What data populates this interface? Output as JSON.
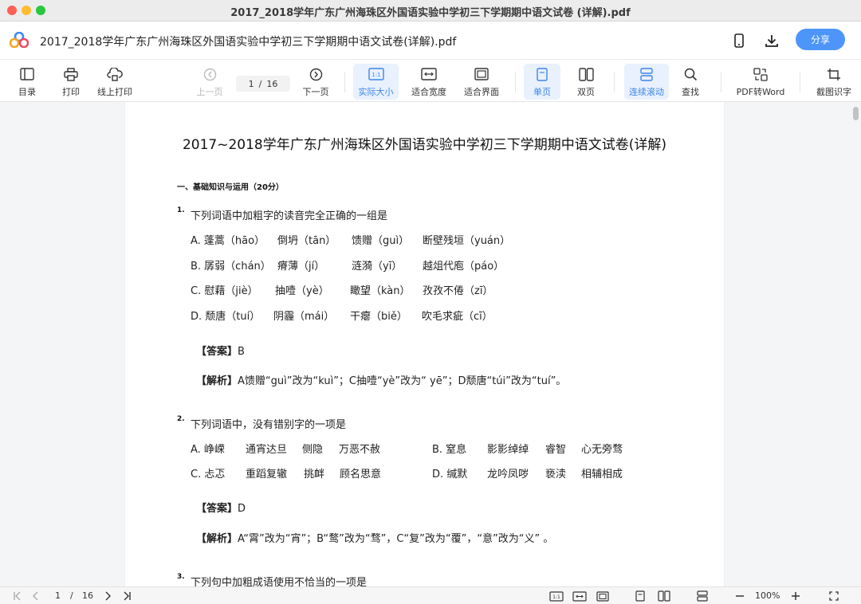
{
  "window": {
    "title": "2017_2018学年广东广州海珠区外国语实验中学初三下学期期中语文试卷 (详解).pdf"
  },
  "header": {
    "doc_title": "2017_2018学年广东广州海珠区外国语实验中学初三下学期期中语文试卷(详解).pdf",
    "share_label": "分享"
  },
  "toolbar": {
    "toc": "目录",
    "print": "打印",
    "online_print": "线上打印",
    "prev": "上一页",
    "current_page": "1",
    "separator": "/",
    "total_pages": "16",
    "next": "下一页",
    "actual_size": "实际大小",
    "fit_width": "适合宽度",
    "fit_page": "适合界面",
    "single_page": "单页",
    "double_page": "双页",
    "continuous": "连续滚动",
    "find": "查找",
    "pdf_to_word": "PDF转Word",
    "screenshot_ocr": "截图识字",
    "actual_size_icon_text": "1:1"
  },
  "document": {
    "title": "2017~2018学年广东广州海珠区外国语实验中学初三下学期期中语文试卷(详解)",
    "section": "一、基础知识与运用（20分）",
    "q1": {
      "num": "1.",
      "text": "下列词语中加粗字的读音完全正确的一组是",
      "options": [
        [
          "A. 蓬蒿（hāo）",
          "倒坍（tān）",
          "馈赠（guì）",
          "断壁残垣（yuán）"
        ],
        [
          "B. 孱弱（chán）",
          "瘠薄（jí）",
          "涟漪（yī）",
          "越俎代庖（páo）"
        ],
        [
          "C. 慰藉（jiè）",
          "抽噎（yè）",
          "瞰望（kàn）",
          "孜孜不倦（zī）"
        ],
        [
          "D. 颓唐（tuí）",
          "阴霾（mái）",
          "干瘪（biě）",
          "吹毛求疵（cī）"
        ]
      ],
      "answer_label": "【答案】",
      "answer": "B",
      "analysis_label": "【解析】",
      "analysis": "A馈赠“guì”改为“kuì”；C抽噎“yè”改为“ yē”；D颓唐“túi”改为“tuí”。"
    },
    "q2": {
      "num": "2.",
      "text": "下列词语中，没有错别字的一项是",
      "options_left": [
        [
          "A. 峥嵘",
          "通宵达旦",
          "侧隐",
          "万恶不赦"
        ],
        [
          "C. 忐忑",
          "重蹈复辙",
          "挑衅",
          "顾名思意"
        ]
      ],
      "options_right": [
        [
          "B. 窒息",
          "影影绰绰",
          "睿智",
          "心无旁骛"
        ],
        [
          "D. 缄默",
          "龙吟凤哕",
          "亵渎",
          "相辅相成"
        ]
      ],
      "answer_label": "【答案】",
      "answer": "D",
      "analysis_label": "【解析】",
      "analysis": "A“霄”改为“宵”；B“鹜”改为“骛”，C“复”改为“覆”，“意”改为“义” 。"
    },
    "q3": {
      "num": "3.",
      "text": "下列句中加粗成语使用不恰当的一项是"
    }
  },
  "statusbar": {
    "current_page": "1",
    "separator": "/",
    "total_pages": "16",
    "zoom": "100%",
    "actual_size_icon_text": "1:1"
  },
  "colors": {
    "accent": "#4d95f8",
    "active_bg": "#e8f1fd",
    "active_text": "#3d86e8"
  }
}
